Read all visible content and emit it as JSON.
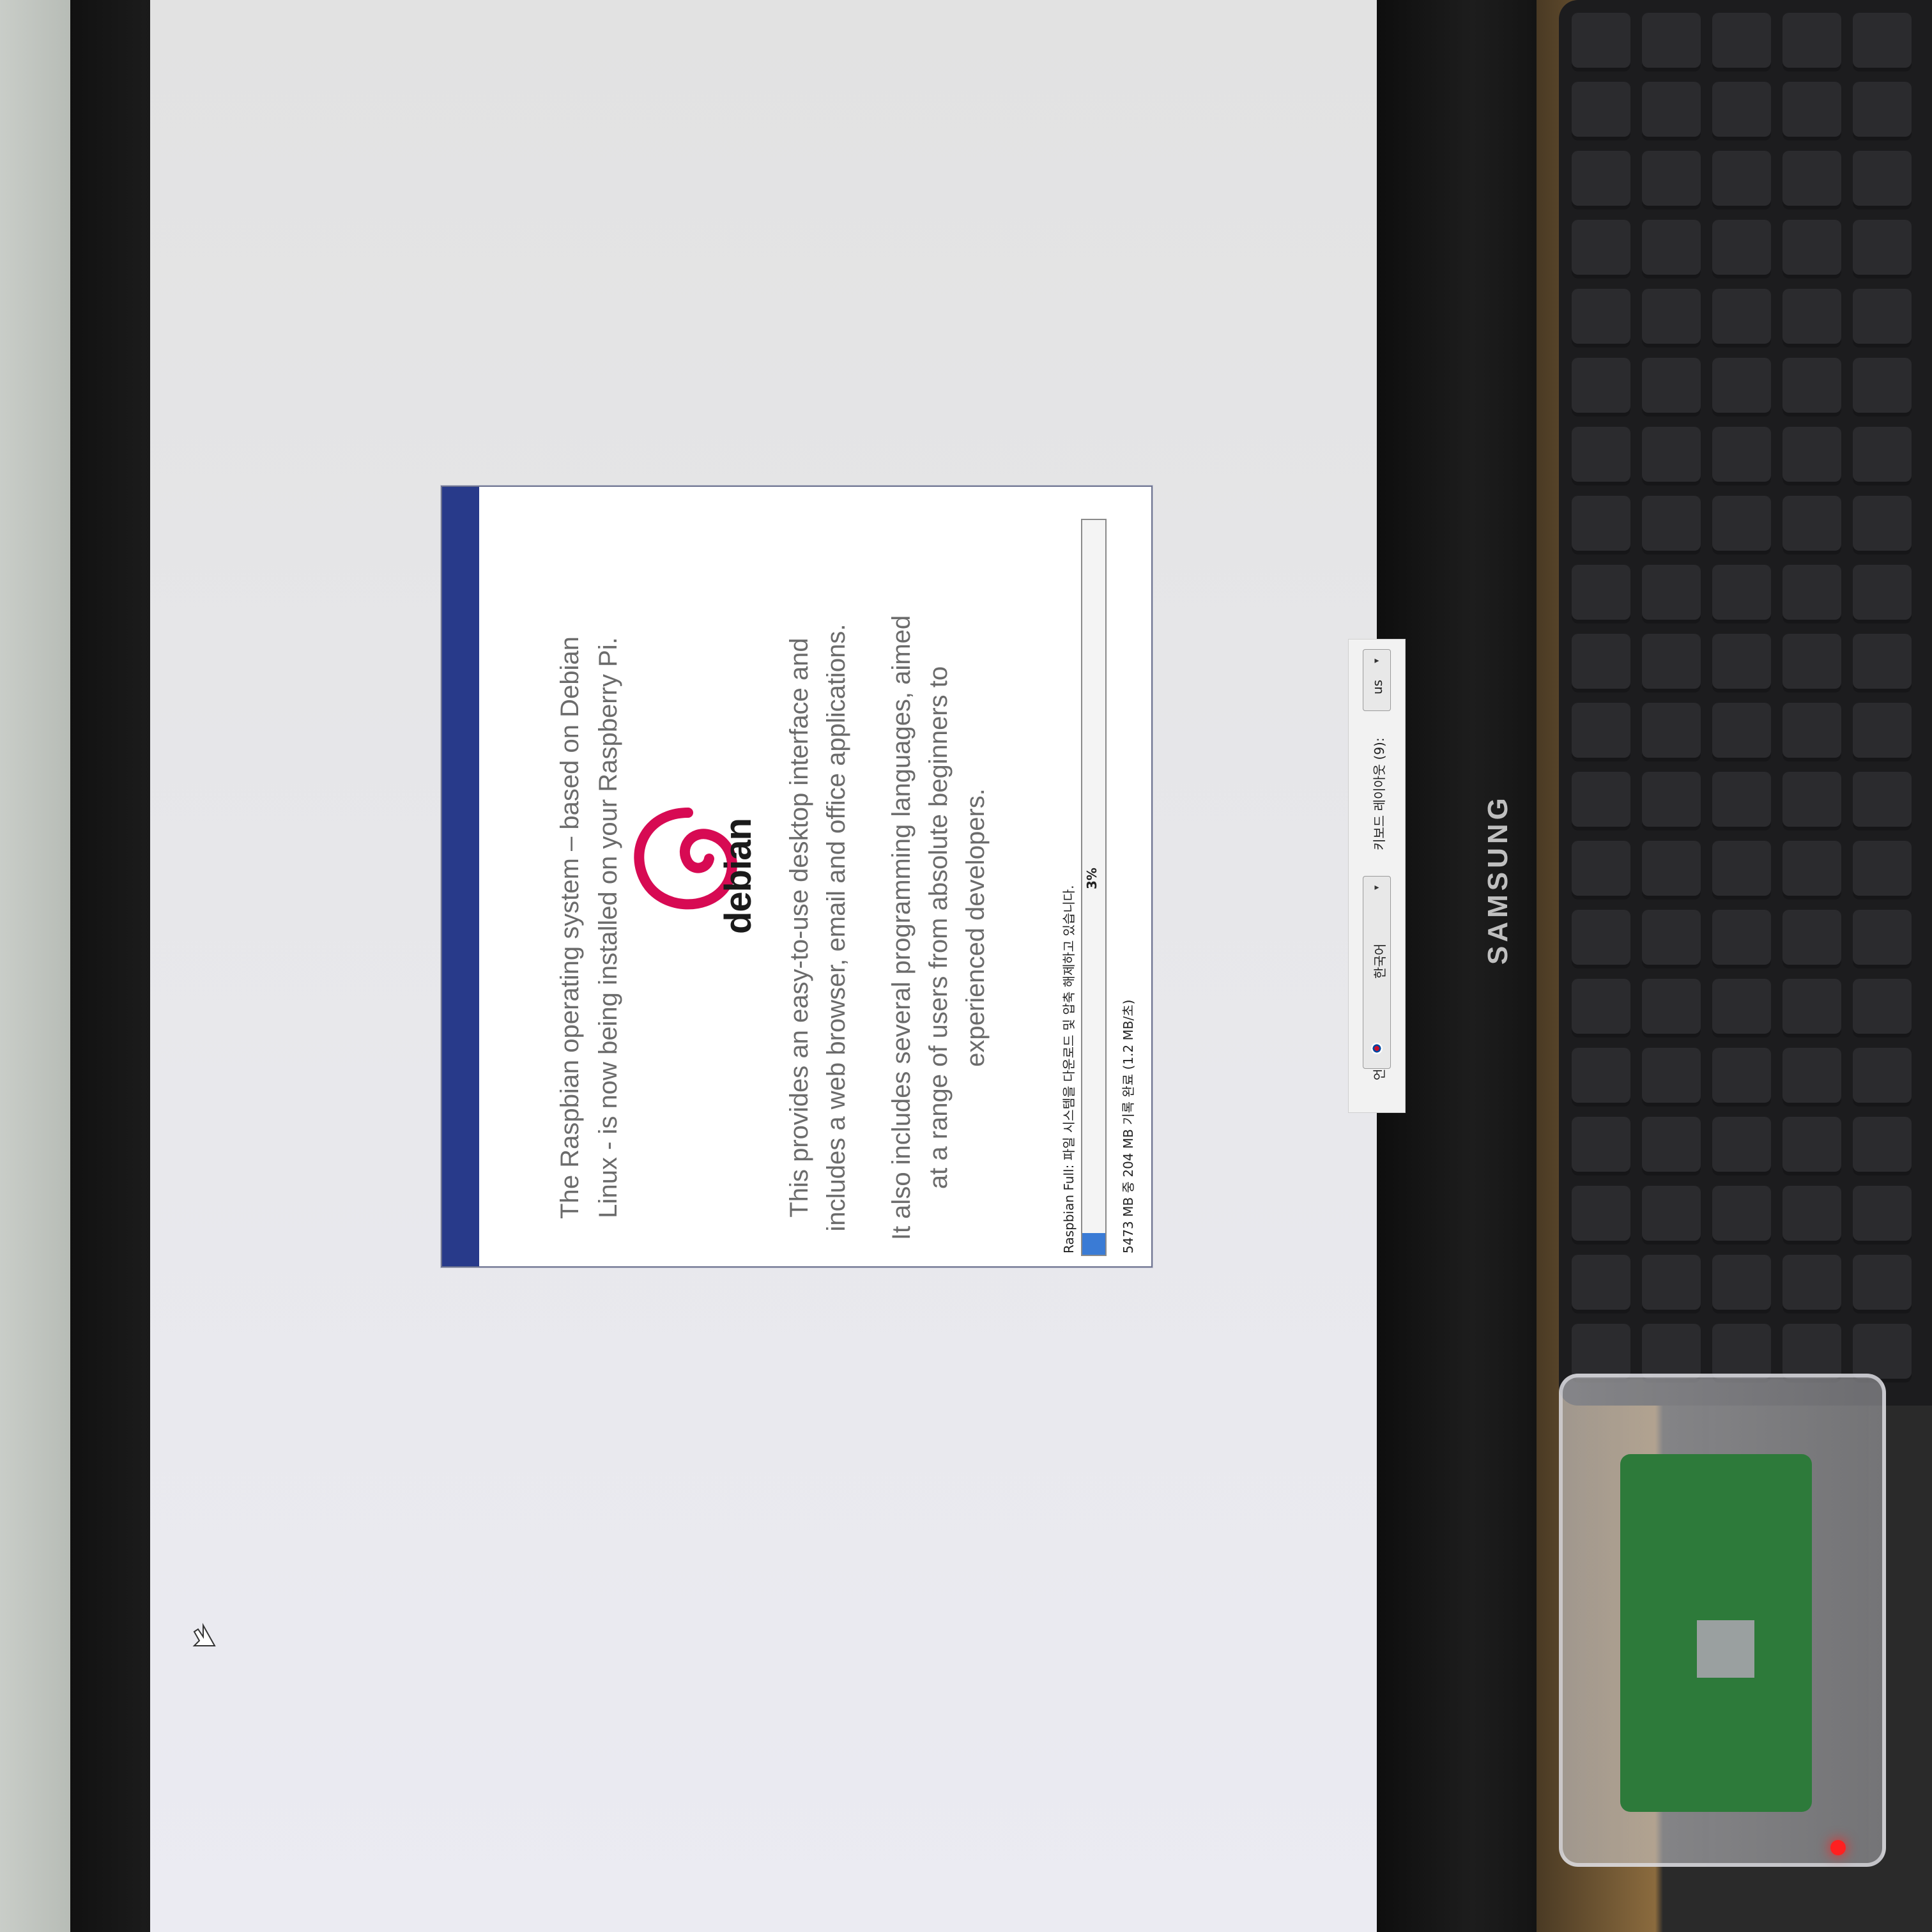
{
  "installer": {
    "paragraph_1": "The Raspbian operating system – based on Debian Linux - is now being installed on your Raspberry Pi.",
    "logo_word": "debian",
    "paragraph_2": "This provides an easy-to-use desktop interface and includes a web browser, email and office applications.",
    "paragraph_3": "It also includes several programming languages, aimed at a range of users from absolute beginners to experienced developers.",
    "status_text": "Raspbian Full: 파일 시스템을 다운로드 및 압축 해제하고 있습니다.",
    "progress_percent": 3,
    "progress_label": "3%",
    "detail_text": "5473 MB 중 204 MB 기록 완료 (1.2 MB/초)"
  },
  "settings_bar": {
    "language_label": "언어 (L):",
    "language_value": "한국어",
    "keyboard_label": "키보드 레이아웃 (9):",
    "keyboard_value": "us"
  },
  "hardware": {
    "monitor_brand": "SAMSUNG"
  },
  "colors": {
    "stripe": "#283a8a",
    "progress": "#3a7bd5",
    "debian_red": "#d70a53"
  }
}
